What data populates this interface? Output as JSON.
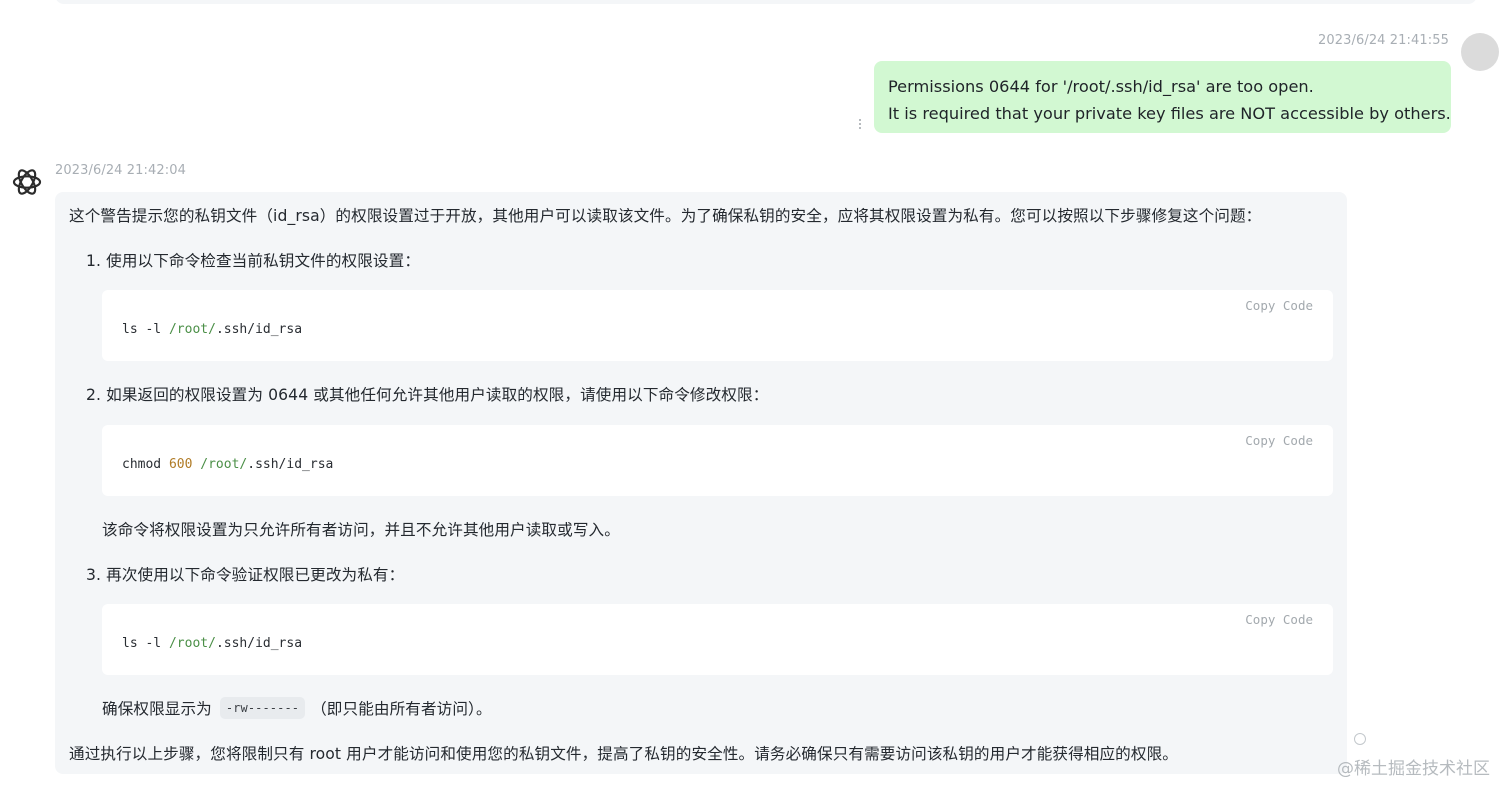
{
  "user_message": {
    "timestamp": "2023/6/24 21:41:55",
    "lines": [
      "Permissions 0644 for '/root/.ssh/id_rsa' are too open.",
      "It is required that your private key files are NOT accessible by others."
    ]
  },
  "bot_message": {
    "timestamp": "2023/6/24 21:42:04",
    "intro": "这个警告提示您的私钥文件（id_rsa）的权限设置过于开放，其他用户可以读取该文件。为了确保私钥的安全，应将其权限设置为私有。您可以按照以下步骤修复这个问题：",
    "steps": [
      {
        "text": "1. 使用以下命令检查当前私钥文件的权限设置：",
        "code": {
          "copy_label": "Copy Code",
          "tokens": [
            {
              "t": "ls -l ",
              "k": "plain"
            },
            {
              "t": "/root/",
              "k": "path"
            },
            {
              "t": ".ssh/id_rsa",
              "k": "plain"
            }
          ]
        }
      },
      {
        "text": "2. 如果返回的权限设置为 0644 或其他任何允许其他用户读取的权限，请使用以下命令修改权限：",
        "code": {
          "copy_label": "Copy Code",
          "tokens": [
            {
              "t": "chmod ",
              "k": "plain"
            },
            {
              "t": "600",
              "k": "num"
            },
            {
              "t": " ",
              "k": "plain"
            },
            {
              "t": "/root/",
              "k": "path"
            },
            {
              "t": ".ssh/id_rsa",
              "k": "plain"
            }
          ]
        },
        "note": "该命令将权限设置为只允许所有者访问，并且不允许其他用户读取或写入。"
      },
      {
        "text": "3. 再次使用以下命令验证权限已更改为私有：",
        "code": {
          "copy_label": "Copy Code",
          "tokens": [
            {
              "t": "ls -l ",
              "k": "plain"
            },
            {
              "t": "/root/",
              "k": "path"
            },
            {
              "t": ".ssh/id_rsa",
              "k": "plain"
            }
          ]
        },
        "note_before": "确保权限显示为",
        "note_code": "-rw-------",
        "note_after": "（即只能由所有者访问）。"
      }
    ],
    "final": "通过执行以上步骤，您将限制只有 root 用户才能访问和使用您的私钥文件，提高了私钥的安全性。请务必确保只有需要访问该私钥的用户才能获得相应的权限。"
  },
  "watermark": "@稀土掘金技术社区",
  "icons": {
    "bot_avatar": "openai-logo-icon",
    "user_avatar": "avatar-placeholder",
    "message_menu": "vertical-dots-icon",
    "loading": "loading-circle-icon"
  },
  "colors": {
    "user_bubble": "#d2f8d2",
    "bot_bubble": "#f4f6f8",
    "code_path": "#4b8f47",
    "code_number": "#b07b26"
  }
}
